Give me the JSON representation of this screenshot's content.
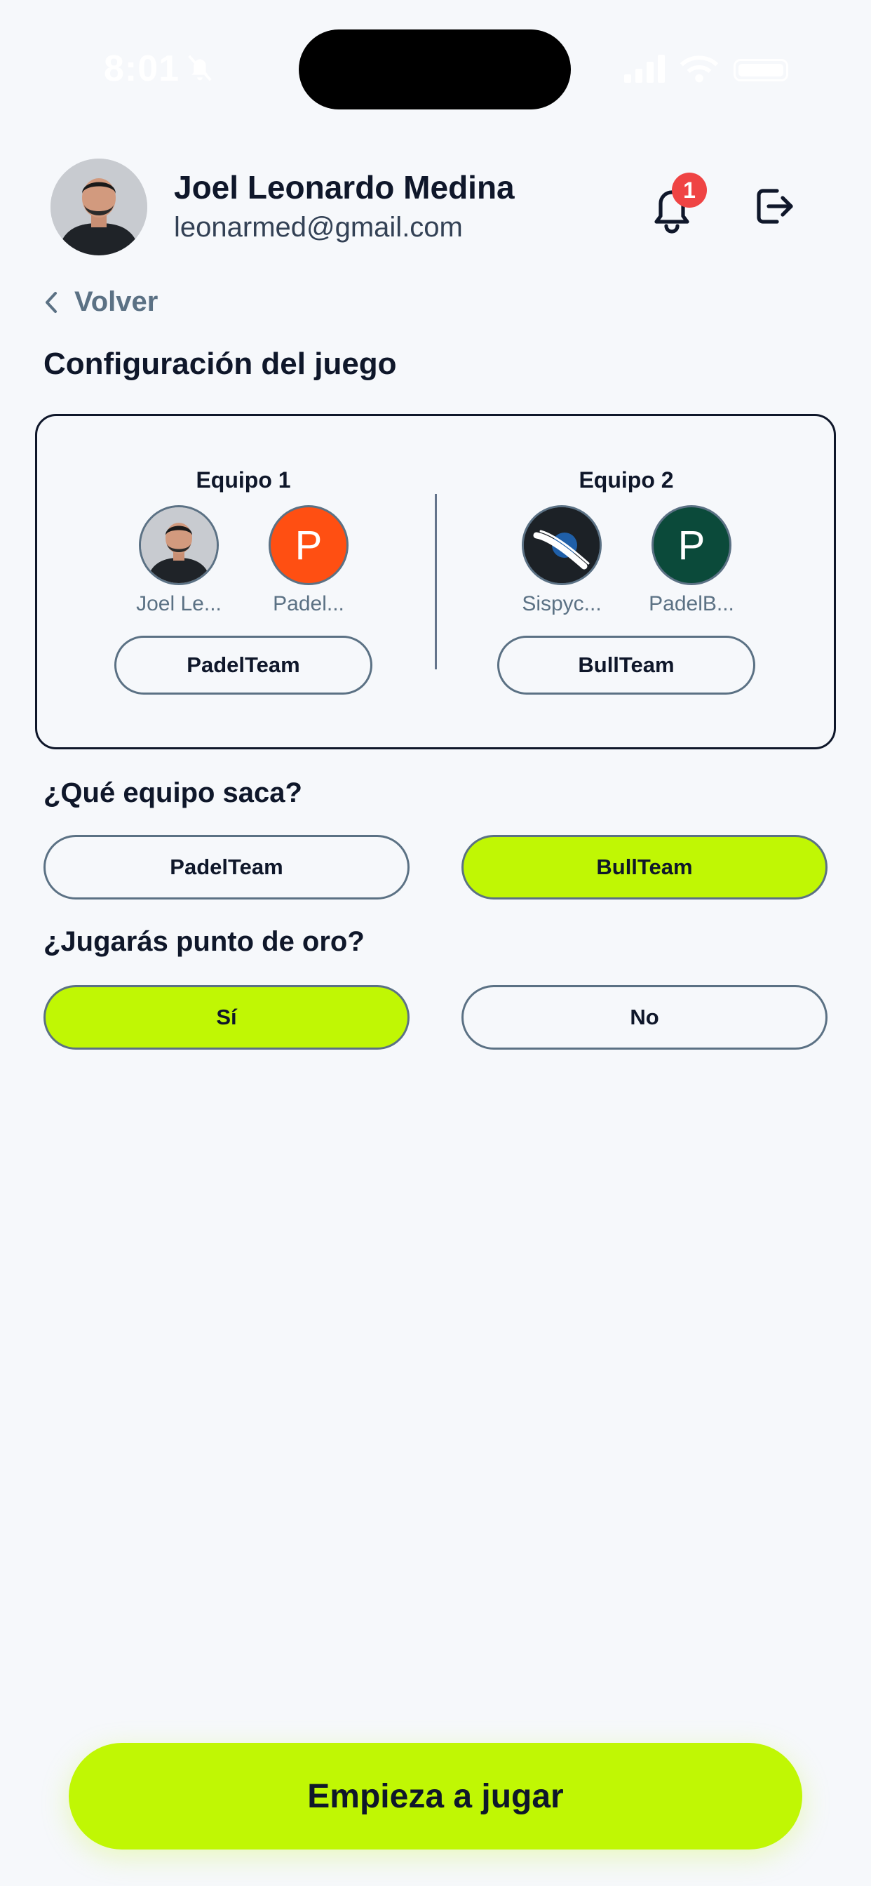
{
  "status_bar": {
    "time": "8:01"
  },
  "header": {
    "user_name": "Joel Leonardo Medina",
    "user_email": "leonarmed@gmail.com",
    "notification_count": "1"
  },
  "nav": {
    "back_label": "Volver"
  },
  "page_title": "Configuración del juego",
  "teams": [
    {
      "title": "Equipo 1",
      "players": [
        {
          "name": "Joel Le...",
          "initial": "",
          "avatar": "photo"
        },
        {
          "name": "Padel...",
          "initial": "P",
          "color": "#ff4f12"
        }
      ],
      "team_name": "PadelTeam"
    },
    {
      "title": "Equipo 2",
      "players": [
        {
          "name": "Sispyc...",
          "initial": "",
          "avatar": "logo"
        },
        {
          "name": "PadelB...",
          "initial": "P",
          "color": "#0b4a3a"
        }
      ],
      "team_name": "BullTeam"
    }
  ],
  "serve_question": {
    "label": "¿Qué equipo saca?",
    "options": [
      "PadelTeam",
      "BullTeam"
    ],
    "selected": "BullTeam"
  },
  "golden_point_question": {
    "label": "¿Jugarás punto de oro?",
    "options": [
      "Sí",
      "No"
    ],
    "selected": "Sí"
  },
  "start_button": "Empieza a jugar",
  "colors": {
    "accent": "#c0f704",
    "badge": "#ef4444",
    "muted": "#5b7184"
  }
}
